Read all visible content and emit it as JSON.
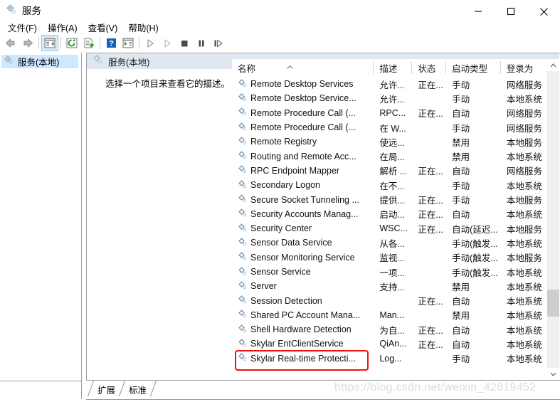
{
  "window": {
    "title": "服务",
    "icon": "services-gear-icon",
    "minimize_label": "最小化",
    "maximize_label": "最大化",
    "close_label": "关闭"
  },
  "menubar": {
    "items": [
      {
        "name": "menu-file",
        "label": "文件(F)",
        "accel": "F"
      },
      {
        "name": "menu-action",
        "label": "操作(A)",
        "accel": "A"
      },
      {
        "name": "menu-view",
        "label": "查看(V)",
        "accel": "V"
      },
      {
        "name": "menu-help",
        "label": "帮助(H)",
        "accel": "H"
      }
    ]
  },
  "toolbar": {
    "buttons": [
      {
        "name": "back-button",
        "icon": "arrow-left-icon",
        "selected": false
      },
      {
        "name": "forward-button",
        "icon": "arrow-right-icon",
        "selected": false
      },
      {
        "name": "show-hide-console-tree-button",
        "icon": "console-tree-icon",
        "selected": true
      },
      {
        "name": "refresh-button",
        "icon": "refresh-icon",
        "selected": false
      },
      {
        "name": "export-list-button",
        "icon": "export-list-icon",
        "selected": false
      },
      {
        "name": "help-button",
        "icon": "question-mark-icon",
        "selected": false
      },
      {
        "name": "show-action-pane-button",
        "icon": "action-pane-icon",
        "selected": false
      },
      {
        "name": "start-service-button",
        "icon": "play-icon",
        "selected": false
      },
      {
        "name": "resume-service-button",
        "icon": "play-dim-icon",
        "selected": false
      },
      {
        "name": "stop-service-button",
        "icon": "stop-icon",
        "selected": false
      },
      {
        "name": "pause-service-button",
        "icon": "pause-icon",
        "selected": false
      },
      {
        "name": "restart-service-button",
        "icon": "restart-icon",
        "selected": false
      }
    ]
  },
  "tree": {
    "root_label": "服务(本地)",
    "root_icon": "services-gear-icon"
  },
  "rightpane": {
    "header_label": "服务(本地)",
    "header_icon": "services-gear-icon",
    "description_placeholder": "选择一个项目来查看它的描述。"
  },
  "table": {
    "sort_column": "名称",
    "sort_direction": "asc",
    "columns": [
      {
        "name": "column-name",
        "label": "名称"
      },
      {
        "name": "column-description",
        "label": "描述"
      },
      {
        "name": "column-status",
        "label": "状态"
      },
      {
        "name": "column-startup-type",
        "label": "启动类型"
      },
      {
        "name": "column-log-on-as",
        "label": "登录为"
      }
    ],
    "rows": [
      {
        "name": "Remote Desktop Services",
        "description": "允许...",
        "status": "正在...",
        "startup": "手动",
        "logon": "网络服务",
        "selected": false
      },
      {
        "name": "Remote Desktop Service...",
        "description": "允许...",
        "status": "",
        "startup": "手动",
        "logon": "本地系统",
        "selected": false
      },
      {
        "name": "Remote Procedure Call (...",
        "description": "RPC...",
        "status": "正在...",
        "startup": "自动",
        "logon": "网络服务",
        "selected": false
      },
      {
        "name": "Remote Procedure Call (...",
        "description": "在 W...",
        "status": "",
        "startup": "手动",
        "logon": "网络服务",
        "selected": false
      },
      {
        "name": "Remote Registry",
        "description": "使远...",
        "status": "",
        "startup": "禁用",
        "logon": "本地服务",
        "selected": false
      },
      {
        "name": "Routing and Remote Acc...",
        "description": "在局...",
        "status": "",
        "startup": "禁用",
        "logon": "本地系统",
        "selected": false
      },
      {
        "name": "RPC Endpoint Mapper",
        "description": "解析 ...",
        "status": "正在...",
        "startup": "自动",
        "logon": "网络服务",
        "selected": false
      },
      {
        "name": "Secondary Logon",
        "description": "在不...",
        "status": "",
        "startup": "手动",
        "logon": "本地系统",
        "selected": false
      },
      {
        "name": "Secure Socket Tunneling ...",
        "description": "提供...",
        "status": "正在...",
        "startup": "手动",
        "logon": "本地服务",
        "selected": false
      },
      {
        "name": "Security Accounts Manag...",
        "description": "启动...",
        "status": "正在...",
        "startup": "自动",
        "logon": "本地系统",
        "selected": false
      },
      {
        "name": "Security Center",
        "description": "WSC...",
        "status": "正在...",
        "startup": "自动(延迟...",
        "logon": "本地服务",
        "selected": false
      },
      {
        "name": "Sensor Data Service",
        "description": "从各...",
        "status": "",
        "startup": "手动(触发...",
        "logon": "本地系统",
        "selected": false
      },
      {
        "name": "Sensor Monitoring Service",
        "description": "监视...",
        "status": "",
        "startup": "手动(触发...",
        "logon": "本地服务",
        "selected": false
      },
      {
        "name": "Sensor Service",
        "description": "一项...",
        "status": "",
        "startup": "手动(触发...",
        "logon": "本地系统",
        "selected": false
      },
      {
        "name": "Server",
        "description": "支持...",
        "status": "",
        "startup": "禁用",
        "logon": "本地系统",
        "selected": false,
        "highlighted": true
      },
      {
        "name": "Session Detection",
        "description": "",
        "status": "正在...",
        "startup": "自动",
        "logon": "本地系统",
        "selected": false
      },
      {
        "name": "Shared PC Account Mana...",
        "description": "Man...",
        "status": "",
        "startup": "禁用",
        "logon": "本地系统",
        "selected": false
      },
      {
        "name": "Shell Hardware Detection",
        "description": "为自...",
        "status": "正在...",
        "startup": "自动",
        "logon": "本地系统",
        "selected": false
      },
      {
        "name": "Skylar EntClientService",
        "description": "QiAn...",
        "status": "正在...",
        "startup": "自动",
        "logon": "本地系统",
        "selected": false
      },
      {
        "name": "Skylar Real-time Protecti...",
        "description": "Log...",
        "status": "",
        "startup": "手动",
        "logon": "本地系统",
        "selected": false
      }
    ]
  },
  "bottom_tabs": [
    {
      "name": "tab-extended",
      "label": "扩展",
      "active": false
    },
    {
      "name": "tab-standard",
      "label": "标准",
      "active": true
    }
  ],
  "watermark": {
    "text": "https://blog.csdn.net/weixin_42819452"
  },
  "colors": {
    "annotation_red": "#ee1111",
    "header_strip": "#dfe8f0",
    "tree_selected": "#cde8ff",
    "toolbar_selected": "#d9ecfb"
  }
}
